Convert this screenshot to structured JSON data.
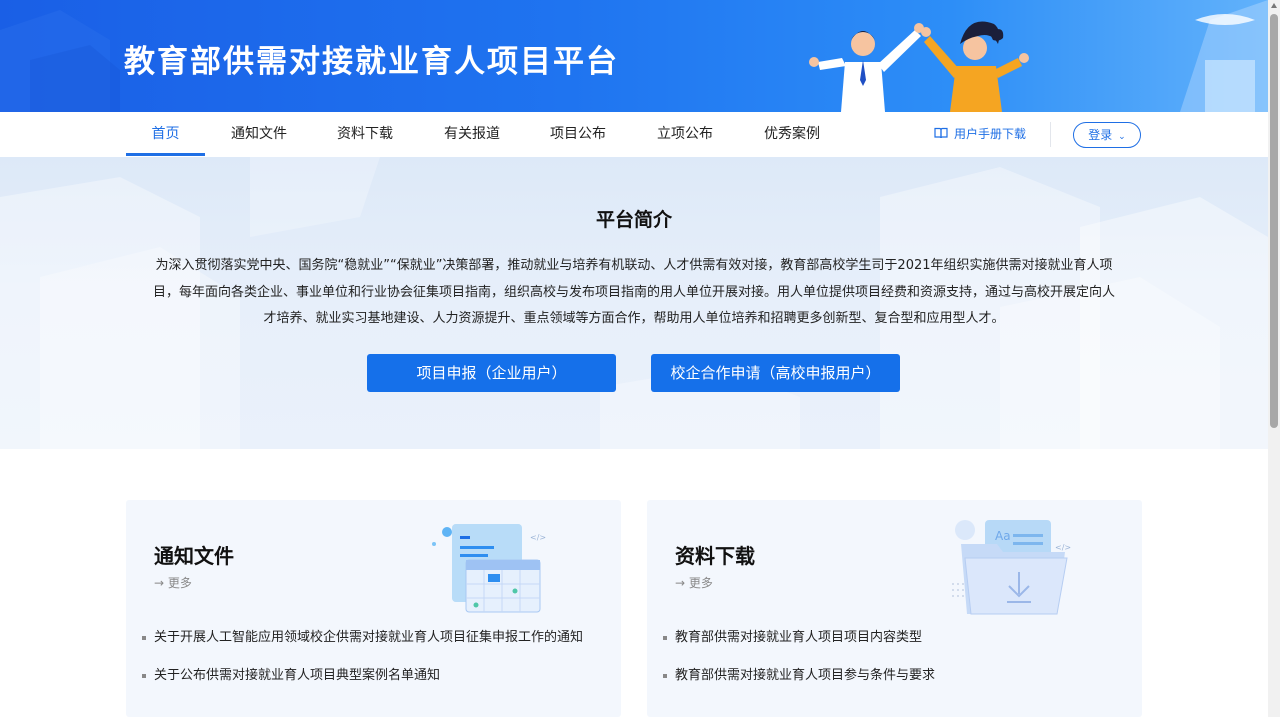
{
  "header": {
    "site_title": "教育部供需对接就业育人项目平台"
  },
  "nav": {
    "items": [
      {
        "label": "首页",
        "active": true
      },
      {
        "label": "通知文件"
      },
      {
        "label": "资料下载"
      },
      {
        "label": "有关报道"
      },
      {
        "label": "项目公布"
      },
      {
        "label": "立项公布"
      },
      {
        "label": "优秀案例"
      }
    ],
    "manual_label": "用户手册下载",
    "login_label": "登录"
  },
  "intro": {
    "title": "平台简介",
    "paragraph": "为深入贯彻落实党中央、国务院“稳就业”“保就业”决策部署，推动就业与培养有机联动、人才供需有效对接，教育部高校学生司于2021年组织实施供需对接就业育人项目，每年面向各类企业、事业单位和行业协会征集项目指南，组织高校与发布项目指南的用人单位开展对接。用人单位提供项目经费和资源支持，通过与高校开展定向人才培养、就业实习基地建设、人力资源提升、重点领域等方面合作，帮助用人单位培养和招聘更多创新型、复合型和应用型人才。",
    "buttons": {
      "enterprise": "项目申报（企业用户）",
      "university": "校企合作申请（高校申报用户）"
    }
  },
  "cards": [
    {
      "title": "通知文件",
      "more": "→ 更多",
      "items": [
        "关于开展人工智能应用领域校企供需对接就业育人项目征集申报工作的通知",
        "关于公布供需对接就业育人项目典型案例名单通知"
      ]
    },
    {
      "title": "资料下载",
      "more": "→ 更多",
      "items": [
        "教育部供需对接就业育人项目项目内容类型",
        "教育部供需对接就业育人项目参与条件与要求"
      ]
    }
  ],
  "colors": {
    "brand": "#1f6fe5",
    "button": "#1570ea",
    "banner_start": "#1a5fe6",
    "banner_end": "#62b2fb"
  }
}
